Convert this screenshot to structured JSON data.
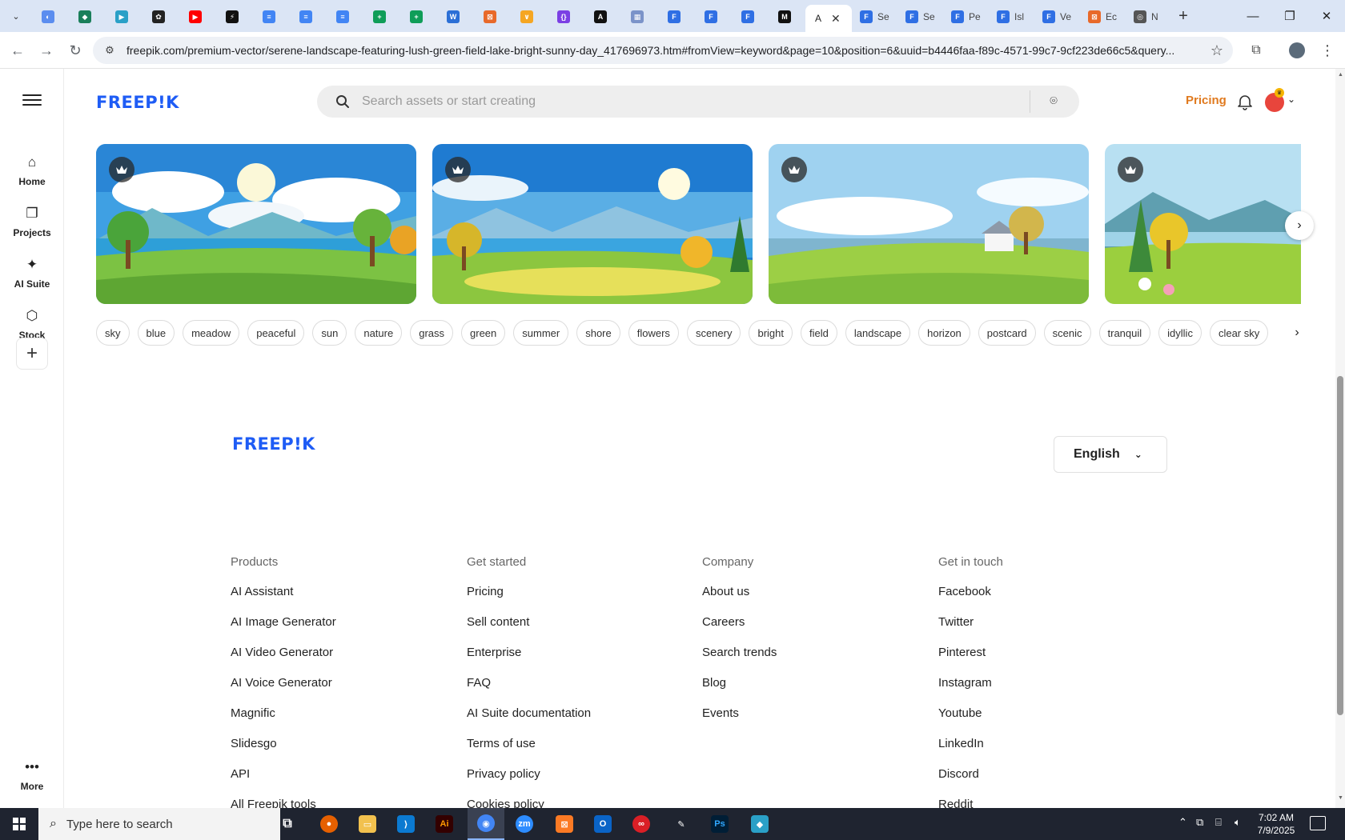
{
  "browser": {
    "tabs": [
      {
        "icon": "app-tab-icon",
        "color": "#5b8def",
        "glyph": "◐"
      },
      {
        "icon": "app-tab-icon",
        "color": "#1a7f5a",
        "glyph": "◆"
      },
      {
        "icon": "app-tab-icon",
        "color": "#2aa0c7",
        "glyph": "▶"
      },
      {
        "icon": "openai-icon",
        "color": "#222222",
        "glyph": "✿"
      },
      {
        "icon": "youtube-icon",
        "color": "#ff0000",
        "glyph": "▶"
      },
      {
        "icon": "bolt-icon",
        "color": "#111111",
        "glyph": "⚡"
      },
      {
        "icon": "docs-icon",
        "color": "#4285f4",
        "glyph": "≡"
      },
      {
        "icon": "docs-icon",
        "color": "#4285f4",
        "glyph": "≡"
      },
      {
        "icon": "docs-icon",
        "color": "#4285f4",
        "glyph": "≡"
      },
      {
        "icon": "sheets-icon",
        "color": "#0f9d58",
        "glyph": "+"
      },
      {
        "icon": "sheets-icon",
        "color": "#0f9d58",
        "glyph": "+"
      },
      {
        "icon": "word-icon",
        "color": "#2b6fd6",
        "glyph": "W"
      },
      {
        "icon": "app-tab-icon",
        "color": "#e8692a",
        "glyph": "⊠"
      },
      {
        "icon": "app-tab-icon",
        "color": "#f5a623",
        "glyph": "∨"
      },
      {
        "icon": "code-icon",
        "color": "#7b3fe4",
        "glyph": "{}"
      },
      {
        "icon": "app-tab-icon",
        "color": "#111111",
        "glyph": "A"
      },
      {
        "icon": "app-tab-icon",
        "color": "#7b93c9",
        "glyph": "▦"
      },
      {
        "icon": "forms-icon",
        "color": "#2f6fe4",
        "glyph": "F"
      },
      {
        "icon": "forms-icon",
        "color": "#2f6fe4",
        "glyph": "F"
      },
      {
        "icon": "forms-icon",
        "color": "#2f6fe4",
        "glyph": "F"
      },
      {
        "icon": "app-tab-icon",
        "color": "#111111",
        "glyph": "M"
      }
    ],
    "active_tab": {
      "title": "A",
      "close": "✕"
    },
    "after_tabs": [
      {
        "title": "Se",
        "color": "#2f6fe4",
        "glyph": "F"
      },
      {
        "title": "Se",
        "color": "#2f6fe4",
        "glyph": "F"
      },
      {
        "title": "Pe",
        "color": "#2f6fe4",
        "glyph": "F"
      },
      {
        "title": "Isl",
        "color": "#2f6fe4",
        "glyph": "F"
      },
      {
        "title": "Ve",
        "color": "#2f6fe4",
        "glyph": "F"
      },
      {
        "title": "Ec",
        "color": "#e8692a",
        "glyph": "⊠"
      },
      {
        "title": "N",
        "color": "#555555",
        "glyph": "◎"
      }
    ],
    "url": "freepik.com/premium-vector/serene-landscape-featuring-lush-green-field-lake-bright-sunny-day_417696973.htm#fromView=keyword&page=10&position=6&uuid=b4446faa-f89c-4571-99c7-9cf223de66c5&query..."
  },
  "header": {
    "logo": "FREEP!K",
    "search_placeholder": "Search assets or start creating",
    "pricing": "Pricing"
  },
  "rail": {
    "items": [
      {
        "label": "Home",
        "icon": "⌂"
      },
      {
        "label": "Projects",
        "icon": "❐"
      },
      {
        "label": "AI Suite",
        "icon": "✦"
      },
      {
        "label": "Stock",
        "icon": "⬡"
      }
    ],
    "more": "More"
  },
  "tags": [
    "sky",
    "blue",
    "meadow",
    "peaceful",
    "sun",
    "nature",
    "grass",
    "green",
    "summer",
    "shore",
    "flowers",
    "scenery",
    "bright",
    "field",
    "landscape",
    "horizon",
    "postcard",
    "scenic",
    "tranquil",
    "idyllic",
    "clear sky"
  ],
  "footer": {
    "logo": "FREEP!K",
    "language": "English",
    "columns": [
      {
        "title": "Products",
        "links": [
          "AI Assistant",
          "AI Image Generator",
          "AI Video Generator",
          "AI Voice Generator",
          "Magnific",
          "Slidesgo",
          "API",
          "All Freepik tools"
        ]
      },
      {
        "title": "Get started",
        "links": [
          "Pricing",
          "Sell content",
          "Enterprise",
          "FAQ",
          "AI Suite documentation",
          "Terms of use",
          "Privacy policy",
          "Cookies policy"
        ]
      },
      {
        "title": "Company",
        "links": [
          "About us",
          "Careers",
          "Search trends",
          "Blog",
          "Events"
        ]
      },
      {
        "title": "Get in touch",
        "links": [
          "Facebook",
          "Twitter",
          "Pinterest",
          "Instagram",
          "Youtube",
          "LinkedIn",
          "Discord",
          "Reddit"
        ]
      }
    ]
  },
  "taskbar": {
    "search_placeholder": "Type here to search",
    "time": "7:02 AM",
    "date": "7/9/2025"
  },
  "colors": {
    "brand": "#1e5cf5",
    "pricing": "#e07a1f"
  }
}
